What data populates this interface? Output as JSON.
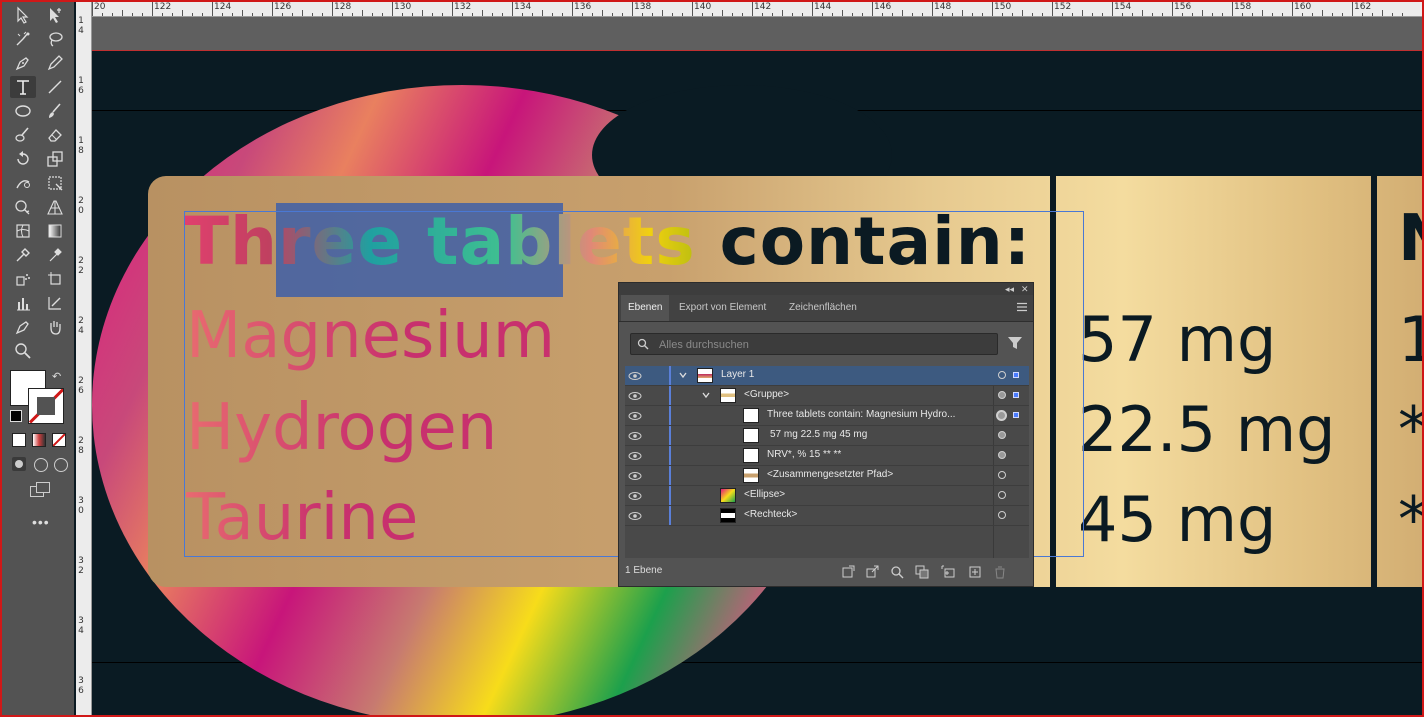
{
  "ruler": {
    "h_labels": [
      "20",
      "122",
      "124",
      "126",
      "128",
      "130",
      "132",
      "134",
      "136",
      "138",
      "140",
      "142",
      "144",
      "146",
      "148",
      "150",
      "152",
      "154",
      "156",
      "158",
      "160",
      "162"
    ],
    "v_labels": [
      "1\n4",
      "1\n6",
      "1\n8",
      "2\n0",
      "2\n2",
      "2\n4",
      "2\n6",
      "2\n8",
      "3\n0",
      "3\n2",
      "3\n4",
      "3\n6"
    ]
  },
  "artwork": {
    "headline": "Three tablets contain:",
    "ingredients": [
      "Magnesium",
      "Hydrogen",
      "Taurine"
    ],
    "values": [
      "57 mg",
      "22.5 mg",
      "45 mg"
    ],
    "col3": [
      "N",
      "1",
      "*",
      "*"
    ]
  },
  "layers_panel": {
    "tabs": [
      "Ebenen",
      "Export von Element",
      "Zeichenflächen"
    ],
    "active_tab": "Ebenen",
    "search_placeholder": "Alles durchsuchen",
    "rows": [
      {
        "name": "Layer 1"
      },
      {
        "name": "<Gruppe>"
      },
      {
        "name": "Three tablets contain: Magnesium Hydro..."
      },
      {
        "name": "57 mg 22.5 mg 45 mg"
      },
      {
        "name": "NRV*, % 15 ** **"
      },
      {
        "name": "<Zusammengesetzter Pfad>"
      },
      {
        "name": "<Ellipse>"
      },
      {
        "name": "<Rechteck>"
      }
    ],
    "footer_count": "1 Ebene"
  },
  "toolbar": {
    "tools": [
      "selection-tool",
      "direct-selection-tool",
      "curvature-tool",
      "lasso-tool",
      "pen-tool",
      "pencil-tool",
      "type-tool",
      "line-tool",
      "ellipse-tool",
      "paintbrush-tool",
      "blob-brush-tool",
      "eraser-tool",
      "rotate-tool",
      "scale-tool",
      "warp-tool",
      "free-transform-tool",
      "shape-builder-tool",
      "perspective-grid-tool",
      "mesh-tool",
      "gradient-tool",
      "eyedropper-tool",
      "measure-tool",
      "symbol-sprayer-tool",
      "artboard-tool",
      "column-graph-tool",
      "slice-tool",
      "hand-tool",
      "zoom-tool"
    ],
    "active_tool": "type-tool"
  },
  "colors": {
    "accent_selection": "#4a78d4",
    "frame_border": "#d01818",
    "panel_bg": "#535353"
  }
}
